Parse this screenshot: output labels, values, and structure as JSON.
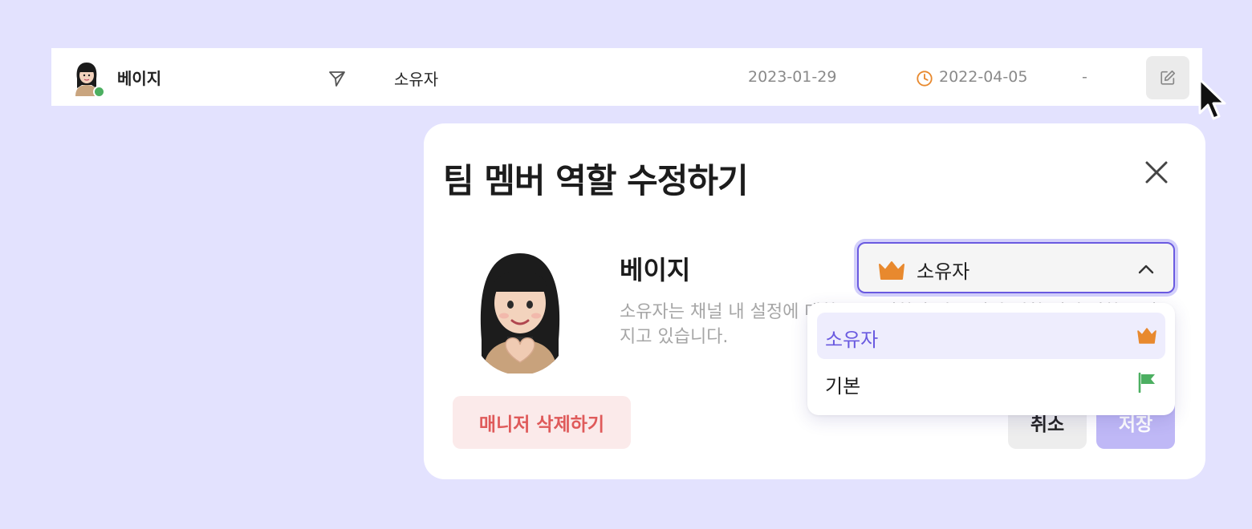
{
  "row": {
    "name": "베이지",
    "role": "소유자",
    "date_joined": "2023-01-29",
    "date_last": "2022-04-05",
    "dash": "-",
    "status_color": "#4caf61",
    "icons": [
      "send-icon",
      "clock-icon",
      "edit-icon"
    ]
  },
  "modal": {
    "title": "팀 멤버 역할 수정하기",
    "member_name": "베이지",
    "description": "소유자는 채널 내 설정에 대한 모든 권한과 다른 사람 역할 변경 권한을 가지고 있습니다.",
    "role_select": {
      "selected": "소유자",
      "icon": "crown-icon",
      "expanded": true
    },
    "delete_button": "매니저 삭제하기",
    "cancel_button": "취소",
    "save_button": "저장"
  },
  "dropdown": {
    "options": [
      {
        "label": "소유자",
        "icon": "crown-icon",
        "selected": true
      },
      {
        "label": "기본",
        "icon": "flag-icon",
        "selected": false
      }
    ]
  },
  "colors": {
    "background": "#e3e2fe",
    "accent": "#6a5ae0",
    "danger": "#df5a5a",
    "crown": "#e8892e",
    "flag": "#4caf61"
  }
}
